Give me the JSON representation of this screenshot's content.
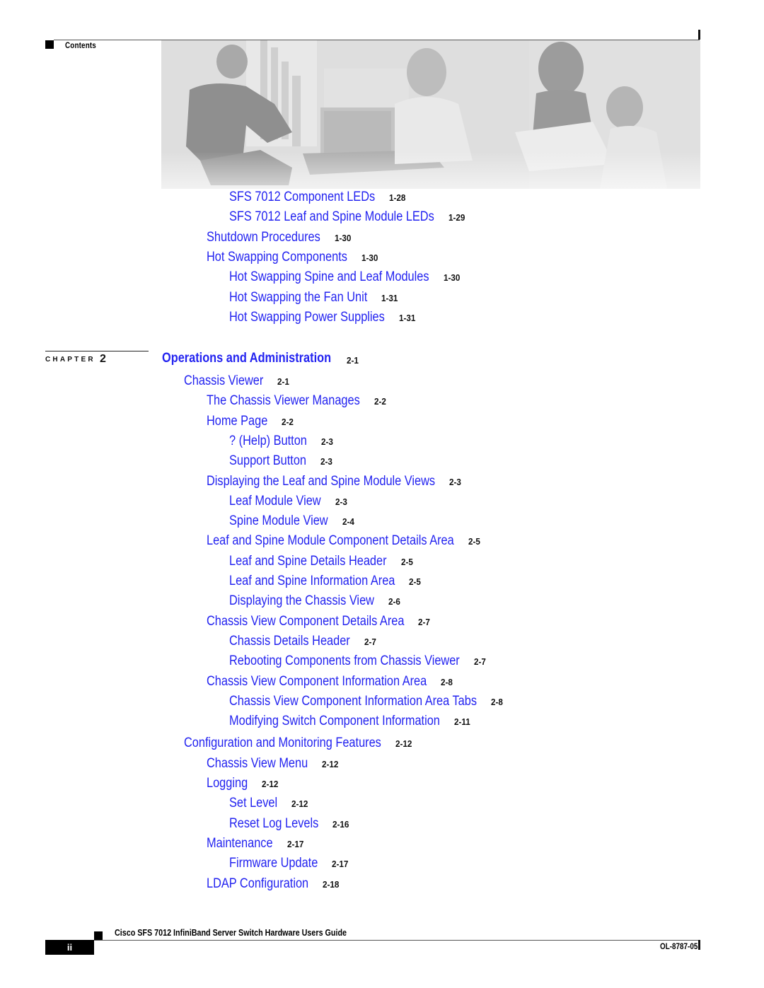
{
  "header": {
    "section_label": "Contents"
  },
  "banner": {
    "image_description": "Faded grayscale photo of four people working with server equipment and a laptop"
  },
  "toc_continued": [
    {
      "title": "SFS 7012 Component LEDs",
      "page": "1-28",
      "level": 3
    },
    {
      "title": "SFS 7012 Leaf and Spine Module LEDs",
      "page": "1-29",
      "level": 3
    },
    {
      "title": "Shutdown Procedures",
      "page": "1-30",
      "level": 2
    },
    {
      "title": "Hot Swapping Components",
      "page": "1-30",
      "level": 2
    },
    {
      "title": "Hot Swapping Spine and Leaf Modules",
      "page": "1-30",
      "level": 3
    },
    {
      "title": "Hot Swapping the Fan Unit",
      "page": "1-31",
      "level": 3
    },
    {
      "title": "Hot Swapping Power Supplies",
      "page": "1-31",
      "level": 3
    }
  ],
  "chapter": {
    "label": "CHAPTER",
    "number": "2",
    "title": "Operations and Administration",
    "page": "2-1"
  },
  "toc_chapter": [
    {
      "title": "Chassis Viewer",
      "page": "2-1",
      "level": 1
    },
    {
      "title": "The Chassis Viewer Manages",
      "page": "2-2",
      "level": 2
    },
    {
      "title": "Home Page",
      "page": "2-2",
      "level": 2
    },
    {
      "title": "? (Help) Button",
      "page": "2-3",
      "level": 3
    },
    {
      "title": "Support Button",
      "page": "2-3",
      "level": 3
    },
    {
      "title": "Displaying the Leaf and Spine Module Views",
      "page": "2-3",
      "level": 2
    },
    {
      "title": "Leaf Module View",
      "page": "2-3",
      "level": 3
    },
    {
      "title": "Spine Module View",
      "page": "2-4",
      "level": 3
    },
    {
      "title": "Leaf and Spine Module Component Details Area",
      "page": "2-5",
      "level": 2
    },
    {
      "title": "Leaf and Spine Details Header",
      "page": "2-5",
      "level": 3
    },
    {
      "title": "Leaf and Spine Information Area",
      "page": "2-5",
      "level": 3
    },
    {
      "title": "Displaying the Chassis View",
      "page": "2-6",
      "level": 3
    },
    {
      "title": "Chassis View Component Details Area",
      "page": "2-7",
      "level": 2
    },
    {
      "title": "Chassis Details Header",
      "page": "2-7",
      "level": 3
    },
    {
      "title": "Rebooting Components from Chassis Viewer",
      "page": "2-7",
      "level": 3
    },
    {
      "title": "Chassis View Component Information Area",
      "page": "2-8",
      "level": 2
    },
    {
      "title": "Chassis View Component Information Area Tabs",
      "page": "2-8",
      "level": 3
    },
    {
      "title": "Modifying Switch Component Information",
      "page": "2-11",
      "level": 3
    },
    {
      "title": "Configuration and Monitoring Features",
      "page": "2-12",
      "level": 1
    },
    {
      "title": "Chassis View Menu",
      "page": "2-12",
      "level": 2
    },
    {
      "title": "Logging",
      "page": "2-12",
      "level": 2
    },
    {
      "title": "Set Level",
      "page": "2-12",
      "level": 3
    },
    {
      "title": "Reset Log Levels",
      "page": "2-16",
      "level": 3
    },
    {
      "title": "Maintenance",
      "page": "2-17",
      "level": 2
    },
    {
      "title": "Firmware Update",
      "page": "2-17",
      "level": 3
    },
    {
      "title": "LDAP Configuration",
      "page": "2-18",
      "level": 2
    }
  ],
  "footer": {
    "guide_title": "Cisco SFS 7012 InfiniBand Server Switch Hardware Users Guide",
    "page_number": "ii",
    "doc_number": "OL-8787-05"
  },
  "colors": {
    "link": "#2323f0",
    "text": "#111111"
  }
}
